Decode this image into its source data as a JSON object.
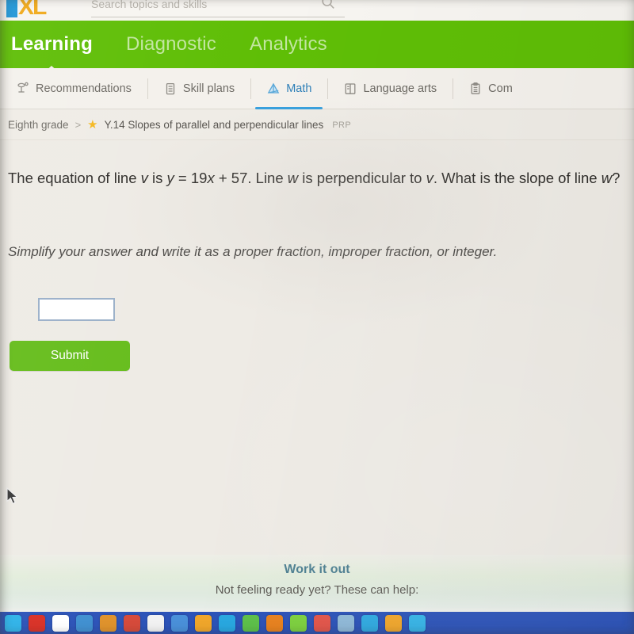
{
  "brand": {
    "logo_letter_i": "I",
    "logo_letters_xl": "XL",
    "nav_green": "#5fbe06",
    "submit_green": "#66bd1c",
    "tab_blue": "#38a0dd",
    "link_teal": "#4d7f91",
    "star_gold": "#f5b820",
    "input_border": "#9bb0c9"
  },
  "search": {
    "placeholder": "Search topics and skills",
    "value": "",
    "icon": "search-icon"
  },
  "primary_nav": {
    "items": [
      {
        "label": "Learning",
        "active": true
      },
      {
        "label": "Diagnostic",
        "active": false
      },
      {
        "label": "Analytics",
        "active": false
      }
    ]
  },
  "subject_tabs": {
    "items": [
      {
        "label": "Recommendations",
        "icon": "recommendations-icon",
        "active": false
      },
      {
        "label": "Skill plans",
        "icon": "skill-plans-icon",
        "active": false
      },
      {
        "label": "Math",
        "icon": "math-pyramid-icon",
        "active": true
      },
      {
        "label": "Language arts",
        "icon": "book-icon",
        "active": false
      },
      {
        "label": "Com",
        "icon": "clipboard-icon",
        "active": false
      }
    ]
  },
  "breadcrumb": {
    "grade": "Eighth grade",
    "separator": ">",
    "star": "★",
    "skill": "Y.14 Slopes of parallel and perpendicular lines",
    "code": "PRP"
  },
  "question": {
    "line1_a": "The equation of line ",
    "line1_v": "v",
    "line1_b": " is ",
    "line1_eq_y": "y",
    "line1_eq_mid": " = 19",
    "line1_eq_x": "x",
    "line1_eq_end": " + 57. Line ",
    "line1_w": "w",
    "line1_c": " is perpendicular to ",
    "line1_v2": "v",
    "line1_d": ". What is the slope of line ",
    "line2_w": "w",
    "line2_end": "?",
    "full_text": "The equation of line v is y = 19x + 57. Line w is perpendicular to v. What is the slope of line w?",
    "hint": "Simplify your answer and write it as a proper fraction, improper fraction, or integer."
  },
  "answer": {
    "value": "",
    "placeholder": ""
  },
  "submit": {
    "label": "Submit"
  },
  "help": {
    "link_label": "Work it out",
    "subtitle": "Not feeling ready yet? These can help:"
  },
  "taskbar": {
    "icon_colors": [
      "#2fb3e8",
      "#d93025",
      "#ffffff",
      "#3f8fd0",
      "#e0922a",
      "#d64a3a",
      "#f2f2f2",
      "#4a90d9",
      "#f0a62b",
      "#29a8e0",
      "#5ec04a",
      "#e8821f",
      "#7dd03f",
      "#e2554a",
      "#8fb8d8",
      "#2fa9e0",
      "#f0a62b",
      "#35b3e6"
    ]
  }
}
